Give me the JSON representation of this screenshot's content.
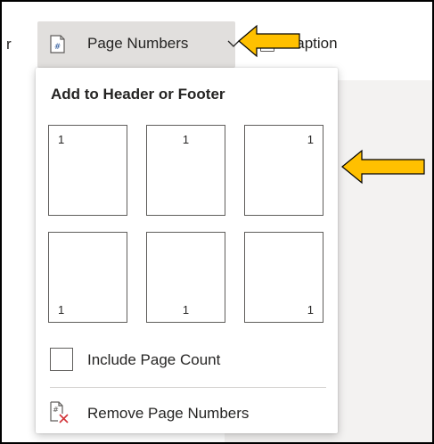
{
  "ribbon": {
    "left_partial_label": "r",
    "page_numbers_label": "Page Numbers",
    "caption_partial_label": "Caption"
  },
  "dropdown": {
    "heading": "Add to Header or Footer",
    "tiles": [
      {
        "name": "top-left",
        "label": "1"
      },
      {
        "name": "top-center",
        "label": "1"
      },
      {
        "name": "top-right",
        "label": "1"
      },
      {
        "name": "bottom-left",
        "label": "1"
      },
      {
        "name": "bottom-center",
        "label": "1"
      },
      {
        "name": "bottom-right",
        "label": "1"
      }
    ],
    "include_page_count_label": "Include Page Count",
    "include_page_count_checked": false,
    "remove_label": "Remove Page Numbers"
  },
  "colors": {
    "button_hover_bg": "#e1dfdd",
    "arrow_fill": "#ffc000",
    "arrow_stroke": "#000000",
    "remove_icon_x": "#d13438"
  },
  "icons": {
    "page_numbers": "page-number-icon",
    "chevron": "chevron-down-icon",
    "caption": "caption-icon",
    "remove": "remove-page-numbers-icon"
  }
}
